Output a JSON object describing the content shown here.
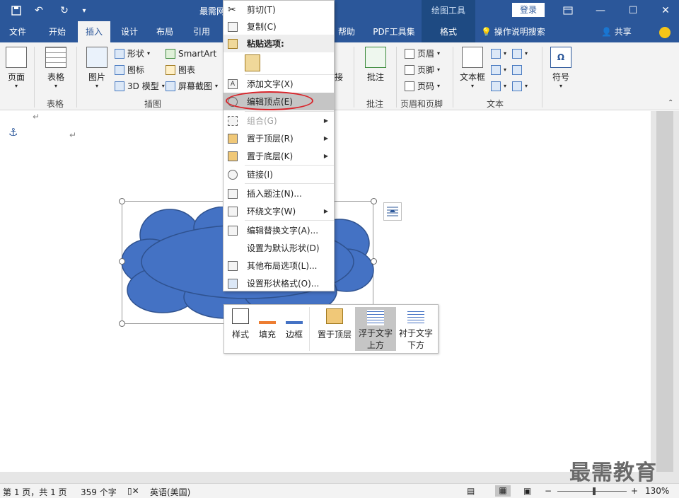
{
  "titlebar": {
    "doc_title": "最需网",
    "context_tab_group": "绘图工具",
    "login_label": "登录"
  },
  "tabs": [
    "文件",
    "开始",
    "插入",
    "设计",
    "布局",
    "引用",
    "帮助",
    "PDF工具集",
    "格式"
  ],
  "tabs_right": {
    "help_search": "操作说明搜索",
    "share": "共享"
  },
  "ribbon": {
    "page": "页面",
    "table": "表格",
    "table_group": "表格",
    "picture": "图片",
    "shapes": "形状",
    "icons": "图标",
    "model3d": "3D 模型",
    "smartart": "SmartArt",
    "chart": "图表",
    "screenshot": "屏幕截图",
    "illustrations_group": "插图",
    "connect": "接",
    "comment": "批注",
    "comment_group": "批注",
    "header": "页眉",
    "footer": "页脚",
    "page_number": "页码",
    "header_footer_group": "页眉和页脚",
    "textbox": "文本框",
    "text_group": "文本",
    "symbol": "符号"
  },
  "context_menu": {
    "items": [
      {
        "label": "剪切(T)"
      },
      {
        "label": "复制(C)"
      },
      {
        "label": "粘贴选项:"
      },
      {
        "label": "添加文字(X)"
      },
      {
        "label": "编辑顶点(E)"
      },
      {
        "label": "组合(G)"
      },
      {
        "label": "置于顶层(R)"
      },
      {
        "label": "置于底层(K)"
      },
      {
        "label": "链接(I)"
      },
      {
        "label": "插入题注(N)..."
      },
      {
        "label": "环绕文字(W)"
      },
      {
        "label": "编辑替换文字(A)..."
      },
      {
        "label": "设置为默认形状(D)"
      },
      {
        "label": "其他布局选项(L)..."
      },
      {
        "label": "设置形状格式(O)..."
      }
    ]
  },
  "mini_toolbar": {
    "style": "样式",
    "fill": "填充",
    "border": "边框",
    "bring_front": "置于顶层",
    "float_above_1": "浮于文字",
    "float_above_2": "上方",
    "behind_1": "衬于文字",
    "behind_2": "下方"
  },
  "watermark": "最需教育",
  "status": {
    "page": "第 1 页，共 1 页",
    "words": "359 个字",
    "language": "英语(美国)",
    "zoom": "130%"
  },
  "colors": {
    "accent": "#2b579a",
    "shape_fill": "#4472c4",
    "highlight_ring": "#d9242a"
  }
}
